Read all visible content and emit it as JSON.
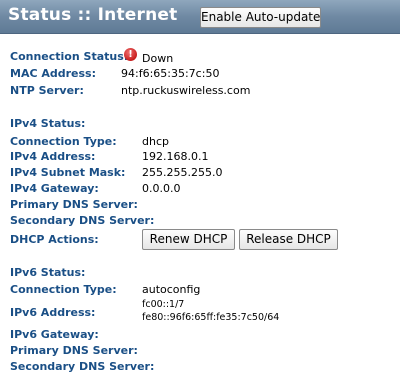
{
  "header": {
    "title": "Status :: Internet",
    "auto_update_label": "Enable Auto-update"
  },
  "general": {
    "connection_status_label": "Connection Status:",
    "connection_status_icon": "alert-icon",
    "connection_status_value": "Down",
    "mac_label": "MAC Address:",
    "mac_value": "94:f6:65:35:7c:50",
    "ntp_label": "NTP Server:",
    "ntp_value": "ntp.ruckuswireless.com"
  },
  "ipv4": {
    "status_label": "IPv4 Status:",
    "connection_type_label": "Connection Type:",
    "connection_type_value": "dhcp",
    "address_label": "IPv4 Address:",
    "address_value": "192.168.0.1",
    "subnet_label": "IPv4 Subnet Mask:",
    "subnet_value": "255.255.255.0",
    "gateway_label": "IPv4 Gateway:",
    "gateway_value": "0.0.0.0",
    "primary_dns_label": "Primary DNS Server:",
    "primary_dns_value": "",
    "secondary_dns_label": "Secondary DNS Server:",
    "secondary_dns_value": "",
    "dhcp_actions_label": "DHCP Actions:",
    "renew_label": "Renew DHCP",
    "release_label": "Release DHCP"
  },
  "ipv6": {
    "status_label": "IPv6 Status:",
    "connection_type_label": "Connection Type:",
    "connection_type_value": "autoconfig",
    "address_label": "IPv6 Address:",
    "address_values": [
      "fc00::1/7",
      "fe80::96f6:65ff:fe35:7c50/64"
    ],
    "gateway_label": "IPv6 Gateway:",
    "gateway_value": "",
    "primary_dns_label": "Primary DNS Server:",
    "primary_dns_value": "",
    "secondary_dns_label": "Secondary DNS Server:",
    "secondary_dns_value": ""
  },
  "colors": {
    "header_bg": "#7890a8",
    "label_text": "#1a4f86",
    "alert": "#c81d1d"
  }
}
